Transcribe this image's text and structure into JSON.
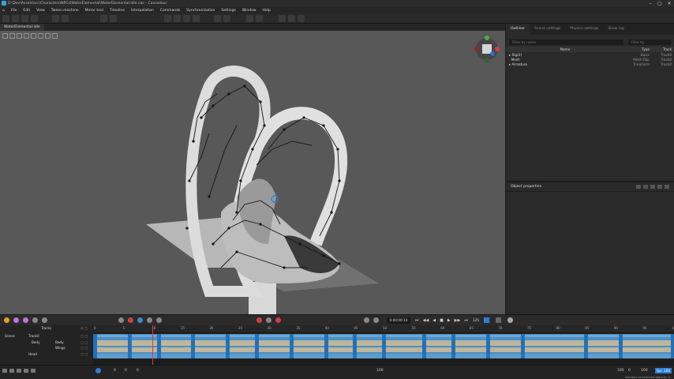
{
  "window": {
    "title": "D:\\Dev\\Assets\\src\\Characters\\NPCs\\WaterElemental\\WaterElemental-idle.cas – Cascadeur",
    "controls": [
      "minimize",
      "maximize",
      "close"
    ]
  },
  "menu": [
    "File",
    "Edit",
    "View",
    "Tween machine",
    "Mirror tool",
    "Timeline",
    "Interpolation",
    "Commands",
    "Synchronization",
    "Settings",
    "Window",
    "Help"
  ],
  "document_tab": "WaterElemental-idle",
  "outliner": {
    "tabs": [
      "Outliner",
      "Scene settings",
      "Physics settings",
      "Show log"
    ],
    "active_tab": "Outliner",
    "filter_placeholder": "Filter by name",
    "filter_by_placeholder": "Filter by",
    "columns": [
      "Name",
      "Type",
      "Track"
    ],
    "rows": [
      {
        "name": "Rig(0)",
        "type": "Basic",
        "track": "Track0"
      },
      {
        "name": "Mesh",
        "type": "Mesh Obj.",
        "track": "Track0"
      },
      {
        "name": "Armature",
        "type": "Transform",
        "track": "Track0"
      }
    ]
  },
  "object_properties": {
    "title": "Object properties"
  },
  "timeline": {
    "current_time": "0:00:00:10",
    "speed": "125",
    "tracks_header": "Tracks",
    "scene_label": "Scene",
    "tracks": [
      "Track0",
      "Body",
      "Body",
      "Wings",
      "Head"
    ],
    "ruler": [
      "0",
      "5",
      "10",
      "15",
      "20",
      "25",
      "30",
      "35",
      "40",
      "45",
      "50",
      "55",
      "60",
      "65",
      "70",
      "75",
      "80",
      "85",
      "90",
      "95",
      "100"
    ],
    "current_frame": 10,
    "range_end": 100,
    "keyframes": [
      0,
      6,
      11,
      17,
      23,
      28,
      34,
      40,
      45,
      50,
      57,
      62,
      68,
      74,
      85,
      91,
      100
    ]
  },
  "statusbar": {
    "start": "0",
    "start2": "0",
    "current": "0",
    "middle": "100",
    "end_a": "100",
    "end_b": "0",
    "end_c": "100",
    "fps": "fps: 100",
    "selected": "Number of selected objects: 0"
  }
}
